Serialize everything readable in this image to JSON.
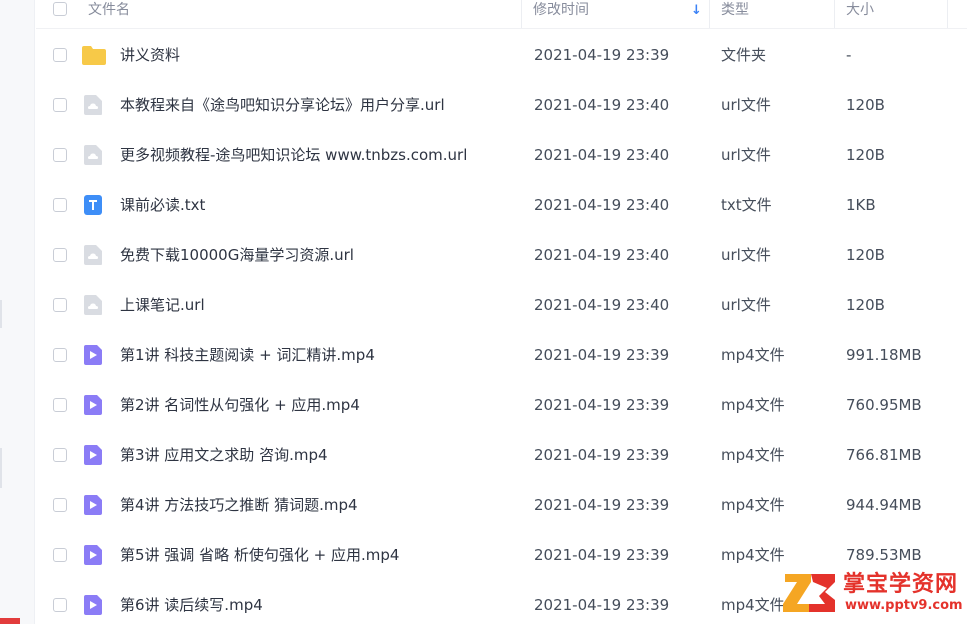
{
  "header": {
    "name": "文件名",
    "time": "修改时间",
    "type": "类型",
    "size": "大小"
  },
  "colors": {
    "accent": "#3b82f6",
    "folder": "#f7c948",
    "url_icon": "#d9dce2",
    "txt_icon": "#3e8ef7",
    "video_icon": "#8b7cf6",
    "watermark": "#e4322b"
  },
  "files": [
    {
      "name": "讲义资料",
      "time": "2021-04-19 23:39",
      "type": "文件夹",
      "size": "-",
      "icon": "folder-icon"
    },
    {
      "name": "本教程来自《途鸟吧知识分享论坛》用户分享.url",
      "time": "2021-04-19 23:40",
      "type": "url文件",
      "size": "120B",
      "icon": "url-file-icon"
    },
    {
      "name": "更多视频教程-途鸟吧知识论坛 www.tnbzs.com.url",
      "time": "2021-04-19 23:40",
      "type": "url文件",
      "size": "120B",
      "icon": "url-file-icon"
    },
    {
      "name": "课前必读.txt",
      "time": "2021-04-19 23:40",
      "type": "txt文件",
      "size": "1KB",
      "icon": "txt-file-icon"
    },
    {
      "name": "免费下载10000G海量学习资源.url",
      "time": "2021-04-19 23:40",
      "type": "url文件",
      "size": "120B",
      "icon": "url-file-icon"
    },
    {
      "name": "上课笔记.url",
      "time": "2021-04-19 23:40",
      "type": "url文件",
      "size": "120B",
      "icon": "url-file-icon"
    },
    {
      "name": "第1讲 科技主题阅读 + 词汇精讲.mp4",
      "time": "2021-04-19 23:39",
      "type": "mp4文件",
      "size": "991.18MB",
      "icon": "video-file-icon"
    },
    {
      "name": "第2讲 名词性从句强化 + 应用.mp4",
      "time": "2021-04-19 23:39",
      "type": "mp4文件",
      "size": "760.95MB",
      "icon": "video-file-icon"
    },
    {
      "name": "第3讲 应用文之求助  咨询.mp4",
      "time": "2021-04-19 23:39",
      "type": "mp4文件",
      "size": "766.81MB",
      "icon": "video-file-icon"
    },
    {
      "name": "第4讲 方法技巧之推断  猜词题.mp4",
      "time": "2021-04-19 23:39",
      "type": "mp4文件",
      "size": "944.94MB",
      "icon": "video-file-icon"
    },
    {
      "name": "第5讲 强调  省略  析使句强化 + 应用.mp4",
      "time": "2021-04-19 23:39",
      "type": "mp4文件",
      "size": "789.53MB",
      "icon": "video-file-icon"
    },
    {
      "name": "第6讲 读后续写.mp4",
      "time": "2021-04-19 23:39",
      "type": "mp4文件",
      "size": "",
      "icon": "video-file-icon"
    }
  ],
  "watermark": {
    "title": "掌宝学资网",
    "url": "www.pptv9.com",
    "logo_text": "Z3"
  }
}
